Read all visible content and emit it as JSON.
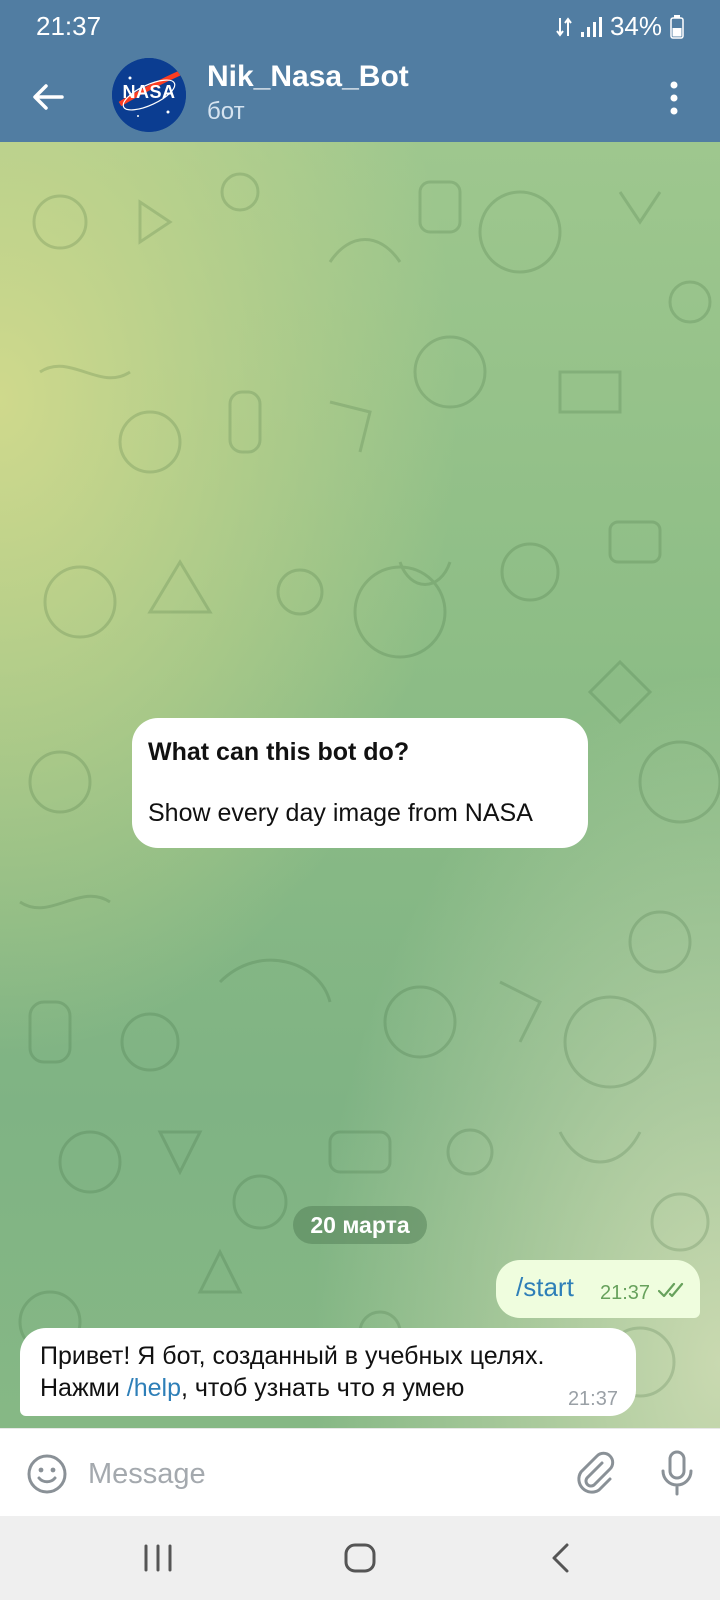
{
  "status": {
    "time": "21:37",
    "battery": "34%"
  },
  "header": {
    "title": "Nik_Nasa_Bot",
    "subtitle": "бот",
    "avatar_text": "NASA"
  },
  "bot_info": {
    "title": "What can this bot do?",
    "text": "Show every day image from NASA"
  },
  "date_separator": "20 марта",
  "messages": [
    {
      "direction": "out",
      "text": "/start",
      "time": "21:37",
      "status": "read"
    },
    {
      "direction": "in",
      "line1": "Привет! Я бот, созданный в учебных целях.",
      "line2_before": "Нажми ",
      "line2_link": "/help",
      "line2_after": ", чтоб узнать что я умею",
      "time": "21:37"
    }
  ],
  "composer": {
    "placeholder": "Message"
  },
  "colors": {
    "header": "#517da2",
    "outgoing_bubble": "#effdde",
    "link": "#2e7fb8",
    "read_check": "#67a15c"
  },
  "icons": {
    "back": "arrow-left-icon",
    "menu": "more-vertical-icon",
    "emoji": "smile-icon",
    "attach": "paperclip-icon",
    "mic": "microphone-icon",
    "check": "double-check-icon"
  }
}
